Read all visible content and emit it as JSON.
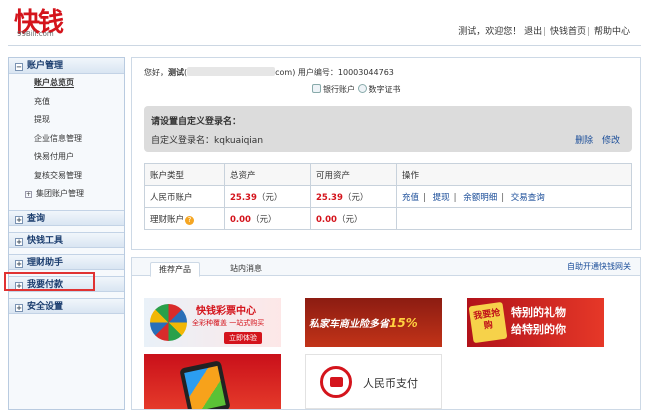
{
  "header": {
    "logo_text": "快钱",
    "logo_domain": "99Bill.com",
    "links": [
      "测试，欢迎您！",
      "退出",
      "快钱首页",
      "帮助中心"
    ]
  },
  "sidebar": {
    "account_mgmt": "账户管理",
    "account_items": [
      "账户总览页",
      "充值",
      "提现",
      "企业信息管理",
      "快易付用户",
      "复核交易管理"
    ],
    "group_account": "集团账户管理",
    "groups": [
      "查询",
      "快钱工具",
      "理财助手",
      "我要付款",
      "安全设置"
    ]
  },
  "main": {
    "greeting_prefix": "您好，",
    "greeting_name": "测试",
    "greeting_open": "(",
    "email_suffix": "com)",
    "user_no_label": "用户编号：",
    "user_no": "10003044763",
    "bank_account_link": "银行账户",
    "cert_link": "数字证书",
    "alias": {
      "title": "请设置自定义登录名：",
      "label": "自定义登录名：",
      "value": "kqkuaiqian",
      "delete": "删除",
      "edit": "修改"
    },
    "table": {
      "headers": [
        "账户类型",
        "总资产",
        "可用资产",
        "操作"
      ],
      "rows": [
        {
          "type": "人民币账户",
          "total": "25.39",
          "available": "25.39",
          "unit": "（元）"
        },
        {
          "type": "理财账户",
          "total": "0.00",
          "available": "0.00",
          "unit": "（元）"
        }
      ],
      "ops": [
        "充值",
        "提现",
        "余额明细",
        "交易查询"
      ]
    }
  },
  "panel": {
    "tabs": [
      "推荐产品",
      "站内消息"
    ],
    "link": "自助开通快钱网关",
    "ads": {
      "lottery_title": "快钱彩票中心",
      "lottery_sub": "全彩种覆盖 一站式购买",
      "lottery_btn": "立即体验",
      "insurance": "私家车商业险多省",
      "insurance_pct": "15%",
      "gift_badge": "我要抢购",
      "gift_text_1": "特别的礼物",
      "gift_text_2": "给特别的你",
      "rmb_pay": "人民币支付"
    }
  }
}
